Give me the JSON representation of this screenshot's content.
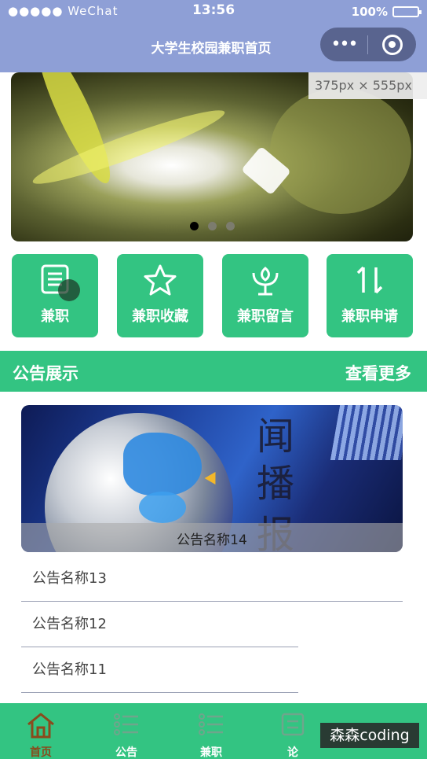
{
  "status": {
    "carrier": "●●●●● WeChat",
    "time": "13:56",
    "battery": "100%"
  },
  "nav": {
    "title": "大学生校园兼职首页",
    "more": "•••"
  },
  "banner": {
    "dimension_tag": "375px × 555px",
    "slides": 3,
    "active_slide": 1
  },
  "quick_buttons": [
    {
      "label": "兼职",
      "icon": "form-icon"
    },
    {
      "label": "兼职收藏",
      "icon": "star-icon"
    },
    {
      "label": "兼职留言",
      "icon": "flower-icon"
    },
    {
      "label": "兼职申请",
      "icon": "sort-icon"
    }
  ],
  "notices": {
    "header": "公告展示",
    "more": "查看更多",
    "featured": {
      "caption": "公告名称14",
      "overlay_chars": [
        "闻",
        "播",
        "报"
      ]
    },
    "items": [
      "公告名称13",
      "公告名称12",
      "公告名称11"
    ]
  },
  "tabbar": [
    {
      "label": "首页",
      "icon": "home-icon",
      "active": true
    },
    {
      "label": "公告",
      "icon": "list-icon",
      "active": false
    },
    {
      "label": "兼职",
      "icon": "list-icon",
      "active": false
    },
    {
      "label": "论",
      "icon": "forum-icon",
      "active": false
    }
  ],
  "watermark": "森森coding",
  "colors": {
    "accent": "#33c482",
    "navbar": "#8e9fd6",
    "capsule": "#59648f"
  }
}
